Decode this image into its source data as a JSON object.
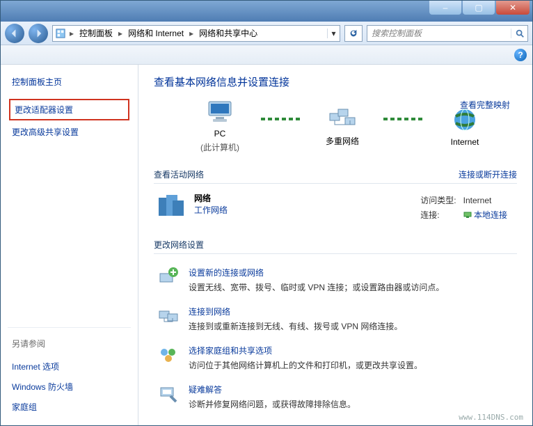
{
  "titlebar": {
    "min": "–",
    "max": "▢",
    "close": "✕"
  },
  "breadcrumb": {
    "root": "控制面板",
    "l2": "网络和 Internet",
    "l3": "网络和共享中心"
  },
  "search": {
    "placeholder": "搜索控制面板"
  },
  "sidebar": {
    "home": "控制面板主页",
    "adapter": "更改适配器设置",
    "advshare": "更改高级共享设置",
    "seealso": "另请参阅",
    "inetopt": "Internet 选项",
    "firewall": "Windows 防火墙",
    "homegroup": "家庭组"
  },
  "main": {
    "title": "查看基本网络信息并设置连接",
    "map_link": "查看完整映射",
    "node_pc": "PC",
    "node_pc_sub": "(此计算机)",
    "node_multi": "多重网络",
    "node_internet": "Internet",
    "sec_active": "查看活动网络",
    "sec_active_link": "连接或断开连接",
    "net_name": "网络",
    "net_type": "工作网络",
    "access_label": "访问类型:",
    "access_value": "Internet",
    "conn_label": "连接:",
    "conn_value": "本地连接",
    "sec_change": "更改网络设置",
    "t1_title": "设置新的连接或网络",
    "t1_desc": "设置无线、宽带、拨号、临时或 VPN 连接；或设置路由器或访问点。",
    "t2_title": "连接到网络",
    "t2_desc": "连接到或重新连接到无线、有线、拨号或 VPN 网络连接。",
    "t3_title": "选择家庭组和共享选项",
    "t3_desc": "访问位于其他网络计算机上的文件和打印机，或更改共享设置。",
    "t4_title": "疑难解答",
    "t4_desc": "诊断并修复网络问题，或获得故障排除信息。"
  },
  "watermark": "www.114DNS.com"
}
